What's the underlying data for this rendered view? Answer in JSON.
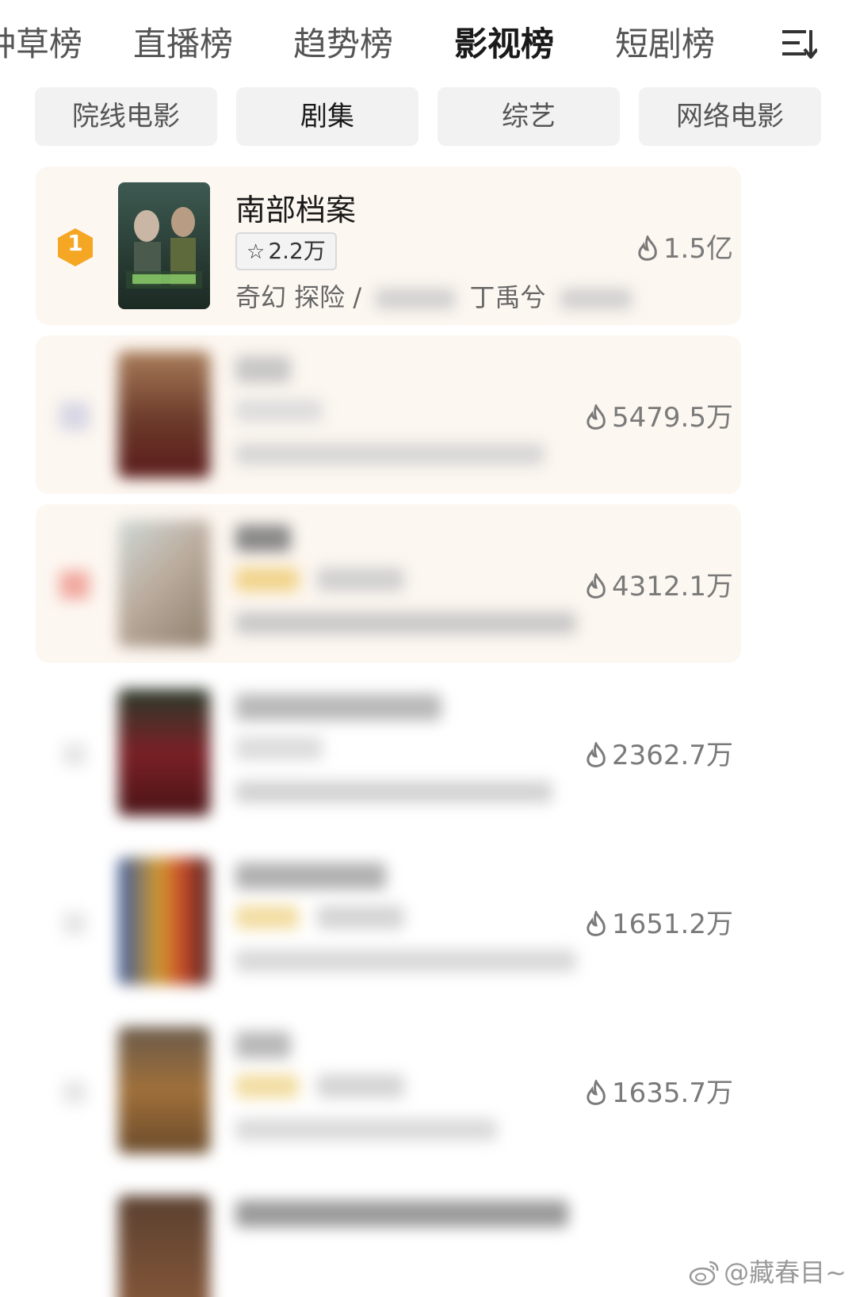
{
  "top_tabs": [
    {
      "label": "种草榜"
    },
    {
      "label": "直播榜"
    },
    {
      "label": "趋势榜"
    },
    {
      "label": "影视榜",
      "active": true
    },
    {
      "label": "短剧榜"
    }
  ],
  "sub_tabs": [
    {
      "label": "院线电影"
    },
    {
      "label": "剧集",
      "active": true
    },
    {
      "label": "综艺"
    },
    {
      "label": "网络电影"
    }
  ],
  "rankings": [
    {
      "rank": "1",
      "title": "南部档案",
      "rating": "2.2万",
      "genres": "奇幻 探险 /",
      "cast": "丁禹兮",
      "heat": "1.5亿",
      "badge_color": "#f5a623"
    },
    {
      "heat": "5479.5万"
    },
    {
      "heat": "4312.1万"
    },
    {
      "heat": "2362.7万"
    },
    {
      "heat": "1651.2万"
    },
    {
      "heat": "1635.7万"
    }
  ],
  "watermark": "@藏春目~",
  "icons": {
    "menu": "list-menu-icon",
    "heat": "flame-icon",
    "star": "star-icon",
    "weibo": "weibo-icon"
  }
}
